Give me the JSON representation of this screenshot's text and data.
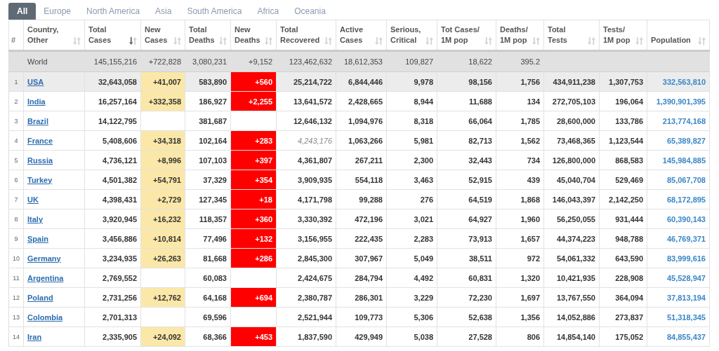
{
  "tabs": [
    {
      "label": "All",
      "selected": true
    },
    {
      "label": "Europe",
      "selected": false
    },
    {
      "label": "North America",
      "selected": false
    },
    {
      "label": "Asia",
      "selected": false
    },
    {
      "label": "South America",
      "selected": false
    },
    {
      "label": "Africa",
      "selected": false
    },
    {
      "label": "Oceania",
      "selected": false
    }
  ],
  "table": {
    "columns": [
      {
        "lines": [
          "#"
        ],
        "kind": "rank",
        "sorted": false
      },
      {
        "lines": [
          "Country,",
          "Other"
        ],
        "kind": "country",
        "sorted": false
      },
      {
        "lines": [
          "Total",
          "Cases"
        ],
        "kind": "plain",
        "sorted": true
      },
      {
        "lines": [
          "New",
          "Cases"
        ],
        "kind": "new-cases",
        "sorted": false
      },
      {
        "lines": [
          "Total",
          "Deaths"
        ],
        "kind": "plain",
        "sorted": false
      },
      {
        "lines": [
          "New",
          "Deaths"
        ],
        "kind": "new-deaths",
        "sorted": false
      },
      {
        "lines": [
          "Total",
          "Recovered"
        ],
        "kind": "recovered",
        "sorted": false
      },
      {
        "lines": [
          "Active",
          "Cases"
        ],
        "kind": "plain",
        "sorted": false
      },
      {
        "lines": [
          "Serious,",
          "Critical"
        ],
        "kind": "plain",
        "sorted": false
      },
      {
        "lines": [
          "Tot Cases/",
          "1M pop"
        ],
        "kind": "plain",
        "sorted": false
      },
      {
        "lines": [
          "Deaths/",
          "1M pop"
        ],
        "kind": "plain",
        "sorted": false
      },
      {
        "lines": [
          "Total",
          "Tests"
        ],
        "kind": "plain",
        "sorted": false
      },
      {
        "lines": [
          "Tests/",
          "1M pop"
        ],
        "kind": "plain",
        "sorted": false
      },
      {
        "lines": [
          "Population"
        ],
        "kind": "population",
        "sorted": false
      }
    ],
    "rows": [
      {
        "kind": "total",
        "selected": false,
        "recovered_estimated": false,
        "cells": [
          null,
          "World",
          "145,155,216",
          "+722,828",
          "3,080,231",
          "+9,152",
          "123,462,632",
          "18,612,353",
          "109,827",
          "18,622",
          "395.2",
          null,
          null,
          null
        ]
      },
      {
        "kind": "country",
        "selected": true,
        "recovered_estimated": false,
        "cells": [
          "1",
          "USA",
          "32,643,058",
          "+41,007",
          "583,890",
          "+560",
          "25,214,722",
          "6,844,446",
          "9,978",
          "98,156",
          "1,756",
          "434,911,238",
          "1,307,753",
          "332,563,810"
        ]
      },
      {
        "kind": "country",
        "selected": false,
        "recovered_estimated": false,
        "cells": [
          "2",
          "India",
          "16,257,164",
          "+332,358",
          "186,927",
          "+2,255",
          "13,641,572",
          "2,428,665",
          "8,944",
          "11,688",
          "134",
          "272,705,103",
          "196,064",
          "1,390,901,395"
        ]
      },
      {
        "kind": "country",
        "selected": false,
        "recovered_estimated": false,
        "cells": [
          "3",
          "Brazil",
          "14,122,795",
          null,
          "381,687",
          null,
          "12,646,132",
          "1,094,976",
          "8,318",
          "66,064",
          "1,785",
          "28,600,000",
          "133,786",
          "213,774,168"
        ]
      },
      {
        "kind": "country",
        "selected": false,
        "recovered_estimated": true,
        "cells": [
          "4",
          "France",
          "5,408,606",
          "+34,318",
          "102,164",
          "+283",
          "4,243,176",
          "1,063,266",
          "5,981",
          "82,713",
          "1,562",
          "73,468,365",
          "1,123,544",
          "65,389,827"
        ]
      },
      {
        "kind": "country",
        "selected": false,
        "recovered_estimated": false,
        "cells": [
          "5",
          "Russia",
          "4,736,121",
          "+8,996",
          "107,103",
          "+397",
          "4,361,807",
          "267,211",
          "2,300",
          "32,443",
          "734",
          "126,800,000",
          "868,583",
          "145,984,885"
        ]
      },
      {
        "kind": "country",
        "selected": false,
        "recovered_estimated": false,
        "cells": [
          "6",
          "Turkey",
          "4,501,382",
          "+54,791",
          "37,329",
          "+354",
          "3,909,935",
          "554,118",
          "3,463",
          "52,915",
          "439",
          "45,040,704",
          "529,469",
          "85,067,708"
        ]
      },
      {
        "kind": "country",
        "selected": false,
        "recovered_estimated": false,
        "cells": [
          "7",
          "UK",
          "4,398,431",
          "+2,729",
          "127,345",
          "+18",
          "4,171,798",
          "99,288",
          "276",
          "64,519",
          "1,868",
          "146,043,397",
          "2,142,250",
          "68,172,895"
        ]
      },
      {
        "kind": "country",
        "selected": false,
        "recovered_estimated": false,
        "cells": [
          "8",
          "Italy",
          "3,920,945",
          "+16,232",
          "118,357",
          "+360",
          "3,330,392",
          "472,196",
          "3,021",
          "64,927",
          "1,960",
          "56,250,055",
          "931,444",
          "60,390,143"
        ]
      },
      {
        "kind": "country",
        "selected": false,
        "recovered_estimated": false,
        "cells": [
          "9",
          "Spain",
          "3,456,886",
          "+10,814",
          "77,496",
          "+132",
          "3,156,955",
          "222,435",
          "2,283",
          "73,913",
          "1,657",
          "44,374,223",
          "948,788",
          "46,769,371"
        ]
      },
      {
        "kind": "country",
        "selected": false,
        "recovered_estimated": false,
        "cells": [
          "10",
          "Germany",
          "3,234,935",
          "+26,263",
          "81,668",
          "+286",
          "2,845,300",
          "307,967",
          "5,049",
          "38,511",
          "972",
          "54,061,332",
          "643,590",
          "83,999,616"
        ]
      },
      {
        "kind": "country",
        "selected": false,
        "recovered_estimated": false,
        "cells": [
          "11",
          "Argentina",
          "2,769,552",
          null,
          "60,083",
          null,
          "2,424,675",
          "284,794",
          "4,492",
          "60,831",
          "1,320",
          "10,421,935",
          "228,908",
          "45,528,947"
        ]
      },
      {
        "kind": "country",
        "selected": false,
        "recovered_estimated": false,
        "cells": [
          "12",
          "Poland",
          "2,731,256",
          "+12,762",
          "64,168",
          "+694",
          "2,380,787",
          "286,301",
          "3,229",
          "72,230",
          "1,697",
          "13,767,550",
          "364,094",
          "37,813,194"
        ]
      },
      {
        "kind": "country",
        "selected": false,
        "recovered_estimated": false,
        "cells": [
          "13",
          "Colombia",
          "2,701,313",
          null,
          "69,596",
          null,
          "2,521,944",
          "109,773",
          "5,306",
          "52,638",
          "1,356",
          "14,052,886",
          "273,837",
          "51,318,345"
        ]
      },
      {
        "kind": "country",
        "selected": false,
        "recovered_estimated": false,
        "cells": [
          "14",
          "Iran",
          "2,335,905",
          "+24,092",
          "68,366",
          "+453",
          "1,837,590",
          "429,949",
          "5,038",
          "27,528",
          "806",
          "14,854,140",
          "175,052",
          "84,855,437"
        ]
      }
    ]
  }
}
